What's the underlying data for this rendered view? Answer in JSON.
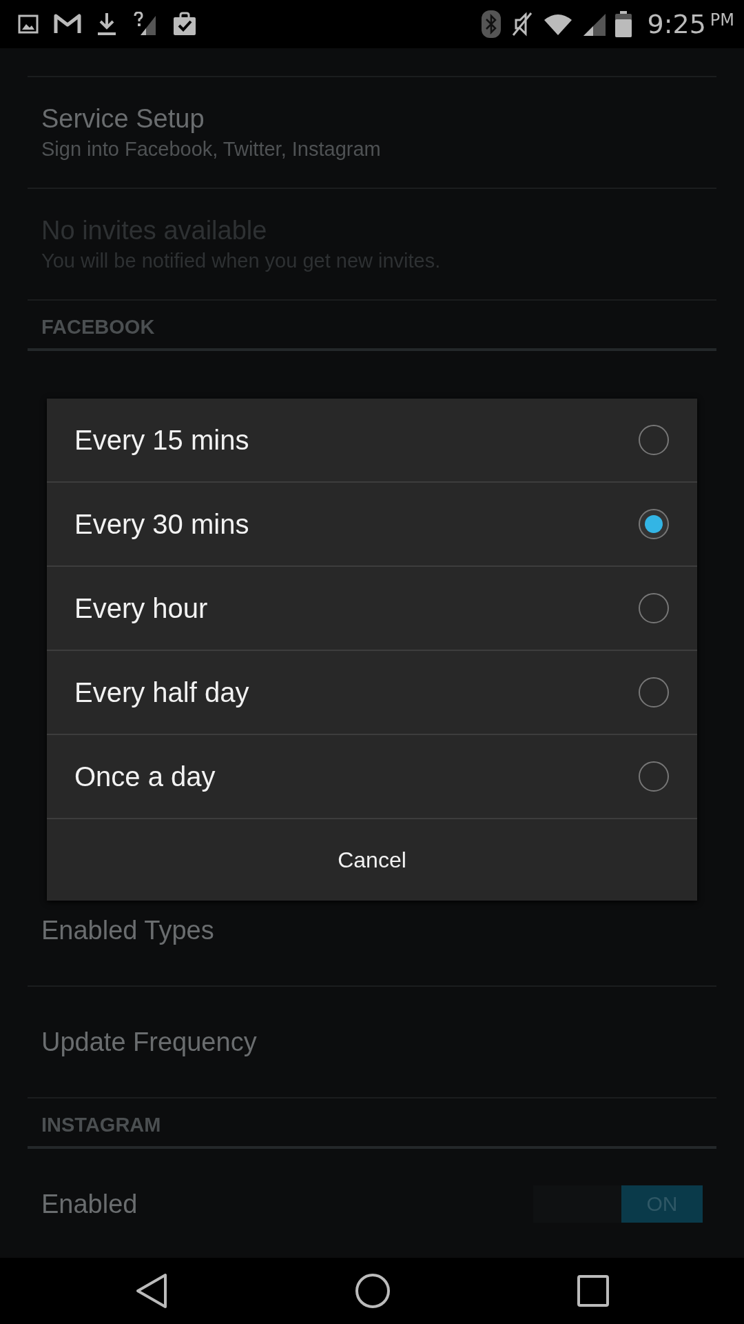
{
  "status_bar": {
    "time": "9:25",
    "ampm": "PM"
  },
  "settings": [
    {
      "kind": "item",
      "title": "Service Setup",
      "subtitle": "Sign into Facebook, Twitter, Instagram",
      "disabled": false
    },
    {
      "kind": "item",
      "title": "No invites available",
      "subtitle": "You will be notified when you get new invites.",
      "disabled": true
    },
    {
      "kind": "header",
      "title": "FACEBOOK"
    },
    {
      "kind": "hidden"
    },
    {
      "kind": "item",
      "title": "Enabled Types",
      "disabled": false
    },
    {
      "kind": "item",
      "title": "Update Frequency",
      "disabled": false
    },
    {
      "kind": "header",
      "title": "INSTAGRAM"
    },
    {
      "kind": "toggle",
      "title": "Enabled",
      "on": true,
      "toggle_label": "ON"
    }
  ],
  "dialog": {
    "options": [
      {
        "label": "Every 15 mins",
        "selected": false
      },
      {
        "label": "Every 30 mins",
        "selected": true
      },
      {
        "label": "Every hour",
        "selected": false
      },
      {
        "label": "Every half day",
        "selected": false
      },
      {
        "label": "Once a day",
        "selected": false
      }
    ],
    "cancel": "Cancel"
  }
}
